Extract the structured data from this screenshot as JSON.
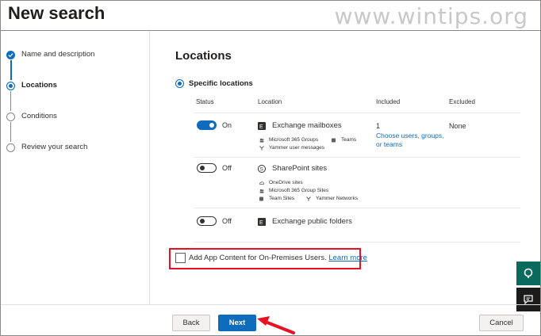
{
  "header": {
    "title": "New search",
    "watermark": "www.wintips.org"
  },
  "wizard": {
    "steps": [
      {
        "label": "Name and description",
        "state": "done"
      },
      {
        "label": "Locations",
        "state": "current"
      },
      {
        "label": "Conditions",
        "state": "pending"
      },
      {
        "label": "Review your search",
        "state": "pending"
      }
    ]
  },
  "main": {
    "title": "Locations",
    "radio_label": "Specific locations",
    "columns": [
      "Status",
      "Location",
      "Included",
      "Excluded"
    ],
    "rows": [
      {
        "toggle": "On",
        "location": "Exchange mailboxes",
        "sub": [
          "Microsoft 365 Groups",
          "Teams",
          "Yammer user messages"
        ],
        "included_count": "1",
        "included_link": "Choose users, groups, or teams",
        "excluded": "None"
      },
      {
        "toggle": "Off",
        "location": "SharePoint sites",
        "sub": [
          "OneDrive sites",
          "Microsoft 365 Group Sites",
          "Team Sites",
          "Yammer Networks"
        ]
      },
      {
        "toggle": "Off",
        "location": "Exchange public folders"
      }
    ],
    "app_content": {
      "label": "Add App Content for On-Premises Users.",
      "link": "Learn more"
    }
  },
  "footer": {
    "back": "Back",
    "next": "Next",
    "cancel": "Cancel"
  },
  "colors": {
    "accent": "#0f6cbd",
    "highlight_box": "#e81123",
    "annotation_arrow": "#e81123",
    "side_button": "#0b6a5e"
  },
  "icons": [
    "check-icon",
    "exchange-icon",
    "sharepoint-icon",
    "people-icon",
    "teams-icon",
    "yammer-icon",
    "cloud-icon",
    "help-icon",
    "feedback-icon"
  ]
}
